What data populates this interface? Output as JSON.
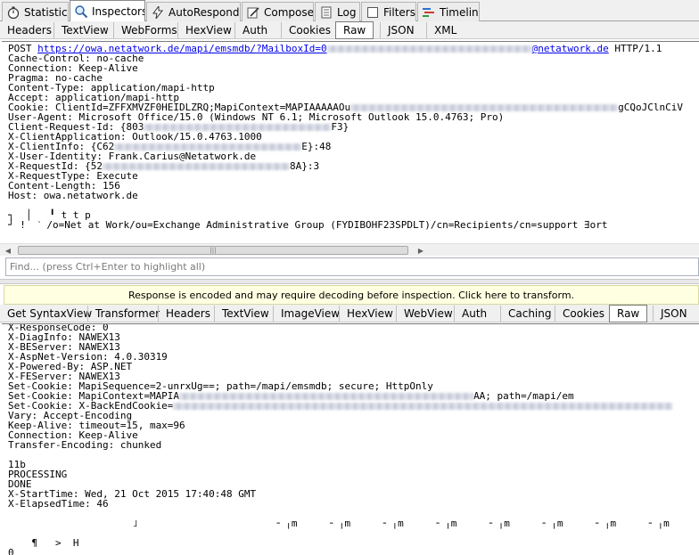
{
  "top_tabs": [
    {
      "label": "Statistics",
      "icon": "stopwatch-icon"
    },
    {
      "label": "Inspectors",
      "icon": "magnifier-icon"
    },
    {
      "label": "AutoResponder",
      "icon": "lightning-icon"
    },
    {
      "label": "Composer",
      "icon": "pencil-icon"
    },
    {
      "label": "Log",
      "icon": "log-icon"
    },
    {
      "label": "Filters",
      "icon": "checkbox-icon"
    },
    {
      "label": "Timeline",
      "icon": "timeline-icon"
    }
  ],
  "request_tabs": [
    "Headers",
    "TextView",
    "WebForms",
    "HexView",
    "Auth",
    "Cookies",
    "Raw",
    "JSON",
    "XML"
  ],
  "request": {
    "method": "POST",
    "url": "https://owa.netatwork.de/mapi/emsmdb/?MailboxId=0",
    "url_tail": "@netatwork.de",
    "protocol": "HTTP/1.1",
    "lines": [
      "Cache-Control: no-cache",
      "Connection: Keep-Alive",
      "Pragma: no-cache",
      "Content-Type: application/mapi-http",
      "Accept: application/mapi-http"
    ],
    "cookie_prefix": "Cookie: ClientId=ZFFXMVZF0HEIDLZRQ;MapiContext=MAPIAAAAAOu",
    "cookie_suffix": "gCQoJClnCiV",
    "lines2": [
      "User-Agent: Microsoft Office/15.0 (Windows NT 6.1; Microsoft Outlook 15.0.4763; Pro)"
    ],
    "request_id_prefix": "Client-Request-Id: {803",
    "request_id_suffix": "F3}",
    "client_app": "X-ClientApplication: Outlook/15.0.4763.1000",
    "client_info_prefix": "X-ClientInfo: {C62",
    "client_info_suffix": "E}:48",
    "user_identity": "X-User-Identity: Frank.Carius@Netatwork.de",
    "requestid_prefix": "X-RequestId: {52",
    "requestid_suffix": "8A}:3",
    "lines3": [
      "X-RequestType: Execute",
      "Content-Length: 156",
      "Host: owa.netatwork.de"
    ],
    "body_line1": "┐  │   ╹ t t p",
    "body_line2": "┘ !  ˋ /o=Net at Work/ou=Exchange Administrative Group (FYDIBOHF23SPDLT)/cn=Recipients/cn=support ∃ort"
  },
  "find_placeholder": "Find... (press Ctrl+Enter to highlight all)",
  "info_bar": "Response is encoded and may require decoding before inspection. Click here to transform.",
  "response_tabs": [
    "Get SyntaxView",
    "Transformer",
    "Headers",
    "TextView",
    "ImageView",
    "HexView",
    "WebView",
    "Auth",
    "Caching",
    "Cookies",
    "Raw",
    "JSON"
  ],
  "response": {
    "lines": [
      "X-ResponseCode: 0",
      "X-DiagInfo: NAWEX13",
      "X-BEServer: NAWEX13",
      "X-AspNet-Version: 4.0.30319",
      "X-Powered-By: ASP.NET",
      "X-FEServer: NAWEX13",
      "Set-Cookie: MapiSequence=2-unrxUg==; path=/mapi/emsmdb; secure; HttpOnly"
    ],
    "cookie2_prefix": "Set-Cookie: MapiContext=MAPIA",
    "cookie2_suffix": "AA; path=/mapi/em",
    "cookie3_prefix": "Set-Cookie: X-BackEndCookie=",
    "lines2": [
      "Vary: Accept-Encoding",
      "Keep-Alive: timeout=15, max=96",
      "Connection: Keep-Alive",
      "Transfer-Encoding: chunked",
      "",
      "11b",
      "PROCESSING",
      "DONE",
      "X-StartTime: Wed, 21 Oct 2015 17:40:48 GMT",
      "X-ElapsedTime: 46",
      "",
      "                     ˩                       ╶ ╷m     ╶ ╷m     ╶ ╷m     ╶ ╷m     ╶ ╷m     ╶ ╷m     ╶ ╷m     ╶ ╷m",
      "",
      "    ¶   >  H",
      "0"
    ]
  }
}
